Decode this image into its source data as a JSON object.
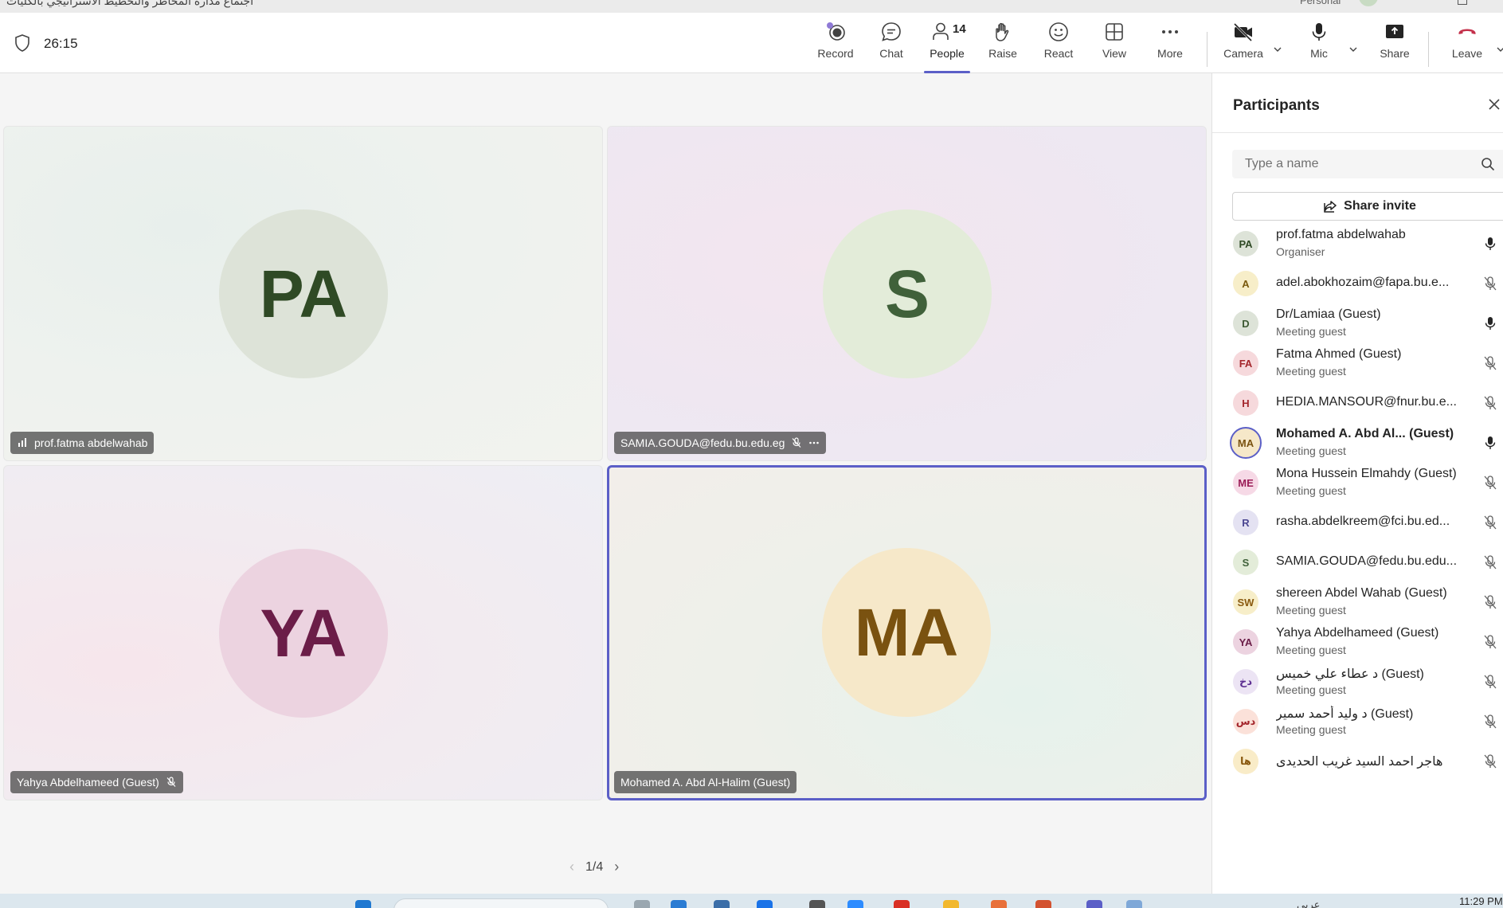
{
  "window": {
    "title": "اجتماع مدارة المخاطر والتخطيط الاستراتيجي بالكليات",
    "persona_label": "Personal"
  },
  "toolbar": {
    "timer": "26:15",
    "record_label": "Record",
    "chat_label": "Chat",
    "people_label": "People",
    "people_count": "14",
    "raise_label": "Raise",
    "react_label": "React",
    "view_label": "View",
    "more_label": "More",
    "camera_label": "Camera",
    "mic_label": "Mic",
    "share_label": "Share",
    "leave_label": "Leave"
  },
  "stage": {
    "tiles": [
      {
        "initials": "PA",
        "name": "prof.fatma abdelwahab",
        "speaking": true
      },
      {
        "initials": "S",
        "name": "SAMIA.GOUDA@fedu.bu.edu.eg",
        "muted": true
      },
      {
        "initials": "YA",
        "name": "Yahya Abdelhameed (Guest)",
        "muted": true
      },
      {
        "initials": "MA",
        "name": "Mohamed A. Abd Al-Halim (Guest)",
        "active": true
      }
    ],
    "pager": "1/4"
  },
  "panel": {
    "title": "Participants",
    "search_placeholder": "Type a name",
    "invite_label": "Share invite",
    "participants": [
      {
        "initials": "PA",
        "name": "prof.fatma abdelwahab",
        "role": "Organiser",
        "mic": "on",
        "bg": "#dde3d8",
        "fg": "#2f4a25"
      },
      {
        "initials": "A",
        "name": "adel.abokhozaim@fapa.bu.e...",
        "role": "",
        "mic": "off",
        "bg": "#f7eec9",
        "fg": "#7a5a0e"
      },
      {
        "initials": "D",
        "name": "Dr/Lamiaa (Guest)",
        "role": "Meeting guest",
        "mic": "on",
        "bg": "#dde3d8",
        "fg": "#3d5a33"
      },
      {
        "initials": "FA",
        "name": "Fatma Ahmed (Guest)",
        "role": "Meeting guest",
        "mic": "off",
        "bg": "#f6d9dc",
        "fg": "#a4262c"
      },
      {
        "initials": "H",
        "name": "HEDIA.MANSOUR@fnur.bu.e...",
        "role": "",
        "mic": "off",
        "bg": "#f6d9dc",
        "fg": "#a4262c"
      },
      {
        "initials": "MA",
        "name": "Mohamed A. Abd Al... (Guest)",
        "role": "Meeting guest",
        "mic": "on",
        "bg": "#f6e8c9",
        "fg": "#7a5210",
        "bold": true,
        "ring": true
      },
      {
        "initials": "ME",
        "name": "Mona Hussein Elmahdy (Guest)",
        "role": "Meeting guest",
        "mic": "off",
        "bg": "#f6d9e6",
        "fg": "#9b1d57"
      },
      {
        "initials": "R",
        "name": "rasha.abdelkreem@fci.bu.ed...",
        "role": "",
        "mic": "off",
        "bg": "#e4e2f2",
        "fg": "#4b4691"
      },
      {
        "initials": "S",
        "name": "SAMIA.GOUDA@fedu.bu.edu...",
        "role": "",
        "mic": "off",
        "bg": "#e3ecd9",
        "fg": "#40613a"
      },
      {
        "initials": "SW",
        "name": "shereen Abdel Wahab (Guest)",
        "role": "Meeting guest",
        "mic": "off",
        "bg": "#f7eec9",
        "fg": "#8a5a10"
      },
      {
        "initials": "YA",
        "name": "Yahya Abdelhameed (Guest)",
        "role": "Meeting guest",
        "mic": "off",
        "bg": "#ecd3e0",
        "fg": "#6b1d48"
      },
      {
        "initials": "دخ",
        "name": "د عطاء علي خميس (Guest)",
        "role": "Meeting guest",
        "mic": "off",
        "bg": "#ece4f4",
        "fg": "#5c2e91"
      },
      {
        "initials": "دس",
        "name": "د وليد أحمد سمير (Guest)",
        "role": "Meeting guest",
        "mic": "off",
        "bg": "#fbe1d9",
        "fg": "#a4262c"
      },
      {
        "initials": "ها",
        "name": "هاجر احمد السيد غريب الحديدى",
        "role": "",
        "mic": "off",
        "bg": "#f9ecc8",
        "fg": "#8a5a10"
      }
    ]
  },
  "taskbar": {
    "clock": "11:29 PM",
    "tray_text": "عربي"
  },
  "colors": {
    "accent": "#5b5fc7",
    "leave_red": "#c4314b"
  }
}
